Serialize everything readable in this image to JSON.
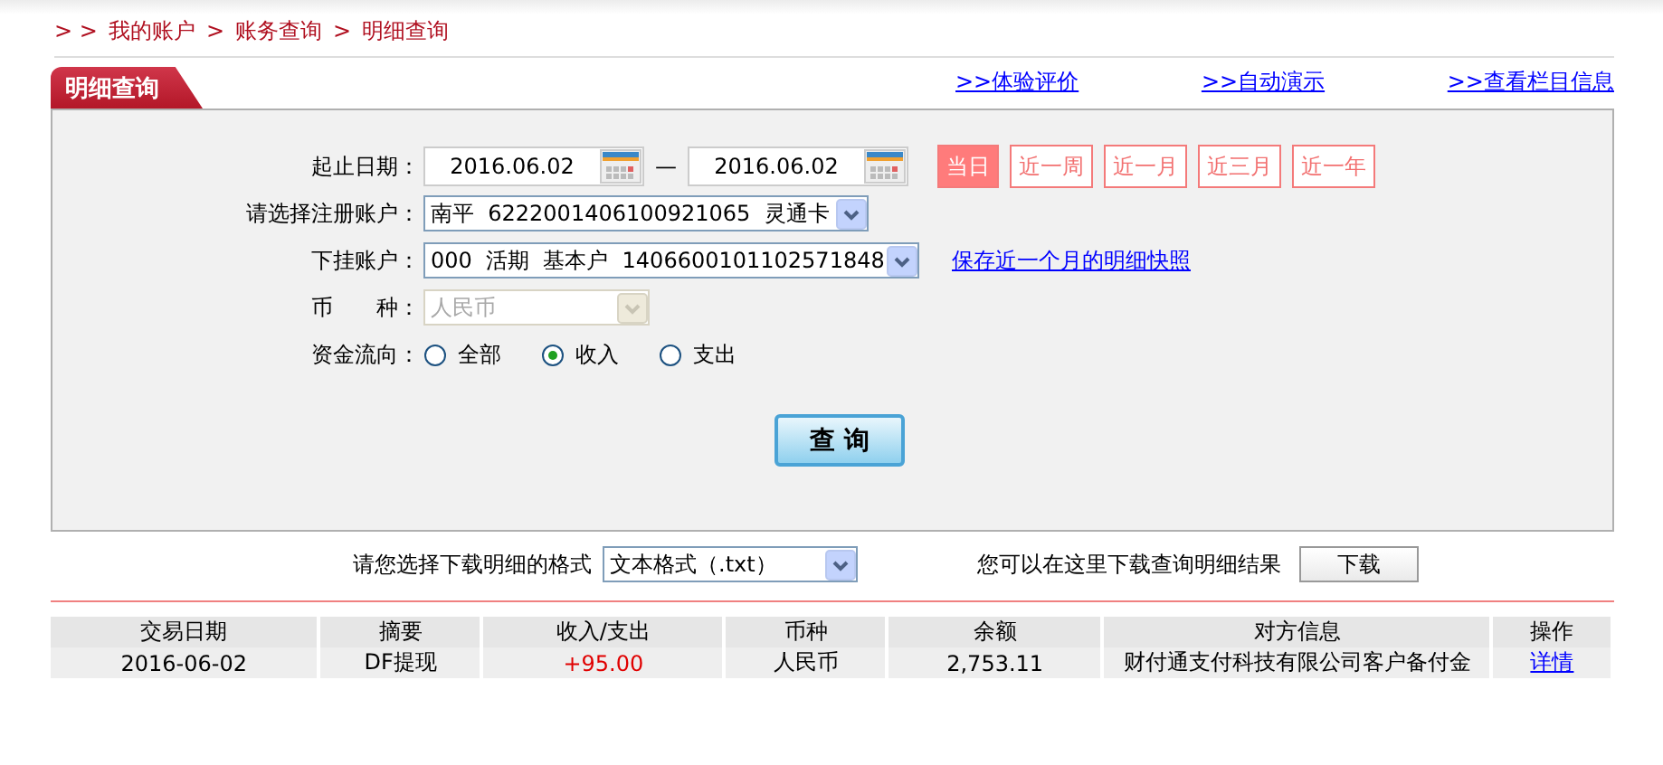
{
  "breadcrumb": {
    "prefix": "> >",
    "items": [
      "我的账户",
      "账务查询",
      "明细查询"
    ],
    "separator": ">"
  },
  "tab": {
    "label": "明细查询"
  },
  "links": [
    {
      "arrows": ">>",
      "label": "体验评价"
    },
    {
      "arrows": ">>",
      "label": "自动演示"
    },
    {
      "arrows": ">>",
      "label": "查看栏目信息"
    }
  ],
  "form": {
    "date_label": "起止日期：",
    "start_date": "2016.06.02",
    "dash": "—",
    "end_date": "2016.06.02",
    "ranges": [
      {
        "label": "当日",
        "selected": true
      },
      {
        "label": "近一周",
        "selected": false
      },
      {
        "label": "近一月",
        "selected": false
      },
      {
        "label": "近三月",
        "selected": false
      },
      {
        "label": "近一年",
        "selected": false
      }
    ],
    "account_label": "请选择注册账户：",
    "account": "南平  6222001406100921065  灵通卡",
    "sub_label": "下挂账户：",
    "sub_account": "000  活期  基本户  1406600101102571848",
    "snapshot_link": "保存近一个月的明细快照",
    "currency_label": "币　　种：",
    "currency": "人民币",
    "currency_disabled": true,
    "flow_label": "资金流向：",
    "flows": [
      {
        "label": "全部",
        "selected": false
      },
      {
        "label": "收入",
        "selected": true
      },
      {
        "label": "支出",
        "selected": false
      }
    ],
    "query_button": "查 询"
  },
  "download": {
    "label": "请您选择下载明细的格式",
    "format": "文本格式（.txt）",
    "hint": "您可以在这里下载查询明细结果",
    "button": "下载"
  },
  "table": {
    "columns": [
      "交易日期",
      "摘要",
      "收入/支出",
      "币种",
      "余额",
      "对方信息",
      "操作"
    ],
    "rows": [
      {
        "cells": [
          "2016-06-02",
          "DF提现",
          "+95.00",
          "人民币",
          "2,753.11",
          "财付通支付科技有限公司客户备付金"
        ],
        "action": "详情"
      }
    ]
  }
}
